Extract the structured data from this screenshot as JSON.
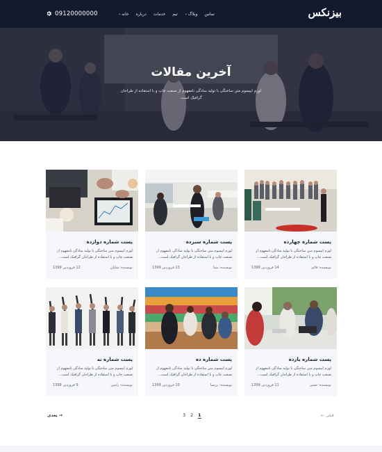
{
  "nav": {
    "logo": "بیزنکس",
    "menu": [
      {
        "label": "خانه",
        "has_caret": true
      },
      {
        "label": "درباره",
        "has_caret": false
      },
      {
        "label": "خدمات",
        "has_caret": false
      },
      {
        "label": "تیم",
        "has_caret": false
      },
      {
        "label": "وبلاگ",
        "has_caret": true
      },
      {
        "label": "تماس",
        "has_caret": false
      }
    ],
    "phone": "09120000000",
    "settings_icon": "gear-icon"
  },
  "hero": {
    "title": "آخرین مقالات",
    "subtitle": "لورم ایپسوم متن ساختگی با تولید سادگی نامفهوم از صنعت چاپ و با استفاده از طراحان گرافیک است."
  },
  "posts": [
    {
      "title": "پست شماره چهارده",
      "excerpt": "لورم ایپسوم متن ساختگی با تولید سادگی نامفهوم از صنعت چاپ و با استفاده از طراحان گرافیک است...",
      "author": "نویسنده: قائم",
      "date": "14 فروردین 1399",
      "image": "conference-room"
    },
    {
      "title": "پست شماره سیزده",
      "excerpt": "لورم ایپسوم متن ساختگی با تولید سادگی نامفهوم از صنعت چاپ و با استفاده از طراحان گرافیک است...",
      "author": "نویسنده: مینا",
      "date": "13 فروردین 1399",
      "image": "office-meeting"
    },
    {
      "title": "پست شماره دوازده",
      "excerpt": "لورم ایپسوم متن ساختگی با تولید سادگی نامفهوم از صنعت چاپ و با استفاده از طراحان گرافیک است...",
      "author": "نویسنده: شایان",
      "date": "12 فروردین 1399",
      "image": "desk-charts"
    },
    {
      "title": "پست شماره یازده",
      "excerpt": "لورم ایپسوم متن ساختگی با تولید سادگی نامفهوم از صنعت چاپ و با استفاده از طراحان گرافیک است...",
      "author": "نویسنده: حسن",
      "date": "11 فروردین 1399",
      "image": "laptop-team"
    },
    {
      "title": "پست شماره ده",
      "excerpt": "لورم ایپسوم متن ساختگی با تولید سادگی نامفهوم از صنعت چاپ و با استفاده از طراحان گرافیک است...",
      "author": "نویسنده: پریسا",
      "date": "10 فروردین 1399",
      "image": "colorful-stairs"
    },
    {
      "title": "پست شماره نه",
      "excerpt": "لورم ایپسوم متن ساختگی با تولید سادگی نامفهوم از صنعت چاپ و با استفاده از طراحان گرافیک است...",
      "author": "نویسنده: رامین",
      "date": "9 فروردین 1399",
      "image": "celebrating-team"
    }
  ],
  "pagination": {
    "prev": "← قبلی",
    "next": "بعدی →",
    "pages": [
      "1",
      "2",
      "3"
    ],
    "current": "1"
  }
}
